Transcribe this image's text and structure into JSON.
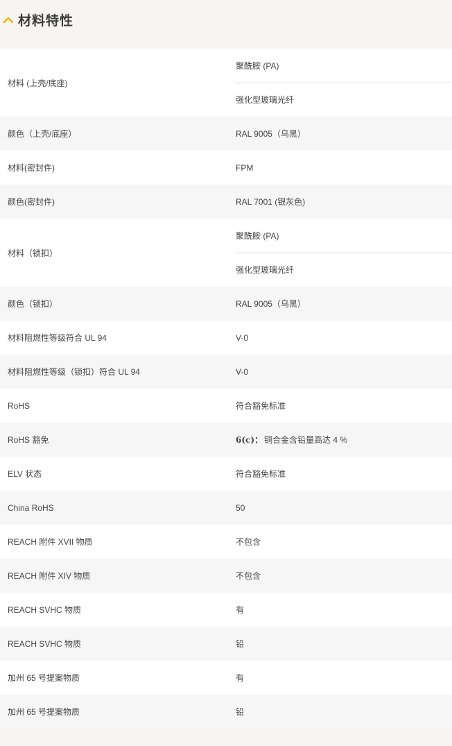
{
  "section": {
    "title": "材料特性",
    "icon": "chevron-up-icon",
    "accent": "#f0b400"
  },
  "rows": [
    {
      "label": "材料 (上壳/底座)",
      "values": [
        "聚酰胺 (PA)",
        "强化型玻璃光纤"
      ]
    },
    {
      "label": "颜色（上壳/底座）",
      "values": [
        "RAL 9005（乌黑）"
      ]
    },
    {
      "label": "材料(密封件)",
      "values": [
        "FPM"
      ]
    },
    {
      "label": "颜色(密封件)",
      "values": [
        "RAL 7001 (银灰色)"
      ]
    },
    {
      "label": "材料（锁扣）",
      "values": [
        "聚酰胺 (PA)",
        "强化型玻璃光纤"
      ]
    },
    {
      "label": "颜色（锁扣）",
      "values": [
        "RAL 9005（乌黑）"
      ]
    },
    {
      "label": "材料阻燃性等级符合 UL 94",
      "values": [
        "V-0"
      ]
    },
    {
      "label": "材料阻燃性等级（锁扣）符合 UL 94",
      "values": [
        "V-0"
      ]
    },
    {
      "label": "RoHS",
      "values": [
        "符合豁免标准"
      ]
    },
    {
      "label": "RoHS 豁免",
      "values": [
        "铜合金含铅量高达 4 %"
      ],
      "value_prefix": "6(c)："
    },
    {
      "label": "ELV 状态",
      "values": [
        "符合豁免标准"
      ]
    },
    {
      "label": "China RoHS",
      "values": [
        "50"
      ]
    },
    {
      "label": "REACH 附件 XVII 物质",
      "values": [
        "不包含"
      ]
    },
    {
      "label": "REACH 附件 XIV 物质",
      "values": [
        "不包含"
      ]
    },
    {
      "label": "REACH SVHC 物质",
      "values": [
        "有"
      ]
    },
    {
      "label": "REACH SVHC 物质",
      "values": [
        "铅"
      ]
    },
    {
      "label": "加州 65 号提案物质",
      "values": [
        "有"
      ]
    },
    {
      "label": "加州 65 号提案物质",
      "values": [
        "铅"
      ]
    }
  ]
}
